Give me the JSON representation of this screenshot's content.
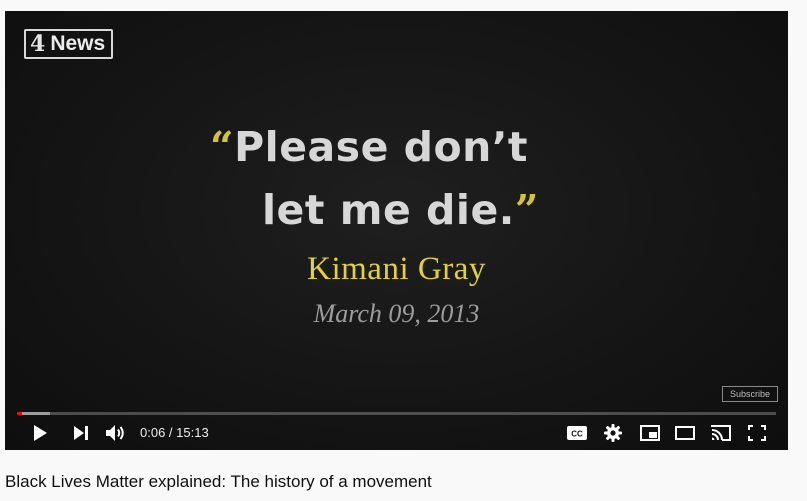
{
  "player": {
    "logo": {
      "mark": "4",
      "text": "News"
    },
    "quote": {
      "open_mark": "“",
      "line1": "Please don’t",
      "line2": "let me die.",
      "close_mark": "”"
    },
    "person_name": "Kimani Gray",
    "date": "March 09, 2013",
    "subscribe_label": "Subscribe",
    "progress": {
      "played_fraction": 0.007,
      "buffered_fraction": 0.043
    },
    "controls": {
      "play_icon": "play-icon",
      "next_icon": "next-icon",
      "volume_icon": "volume-icon",
      "current_time": "0:06",
      "separator": " / ",
      "duration": "15:13",
      "captions_label": "CC",
      "settings_icon": "gear-icon",
      "miniplayer_icon": "miniplayer-icon",
      "theater_icon": "theater-icon",
      "cast_icon": "cast-icon",
      "fullscreen_icon": "fullscreen-icon"
    }
  },
  "video_title": "Black Lives Matter explained: The history of a movement",
  "colors": {
    "progress_played": "#ff0000",
    "quote_mark": "#d6c23a",
    "person_name": "#e3d13a",
    "date": "#9d9d9d"
  }
}
